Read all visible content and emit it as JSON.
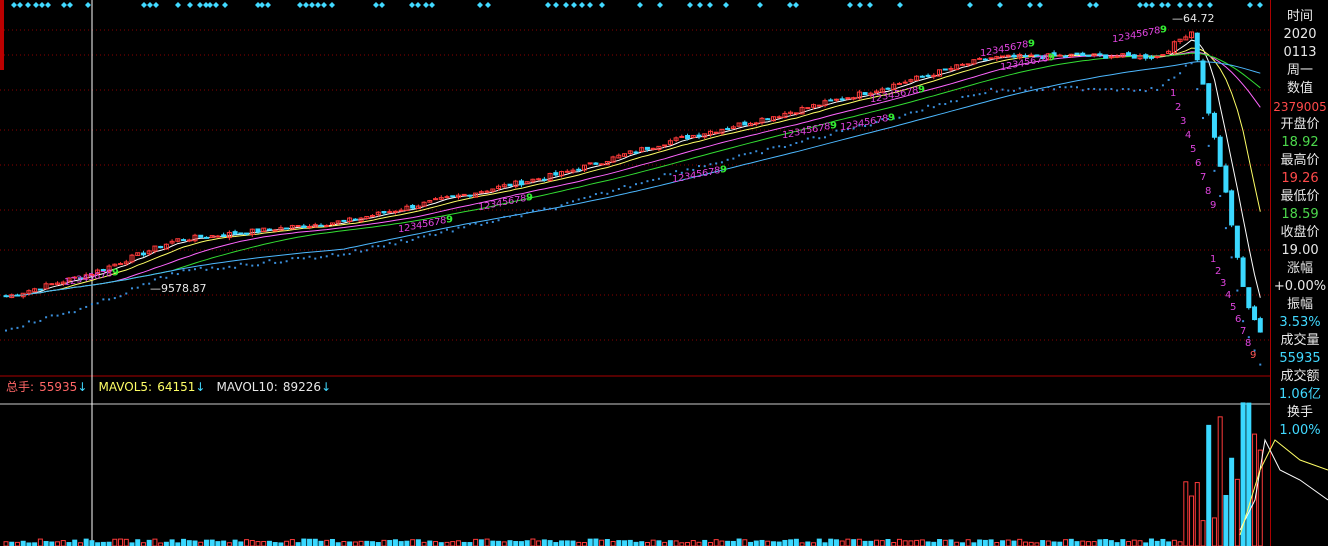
{
  "colors": {
    "background": "#000000",
    "up": "#ff3b3b",
    "down": "#3bd8ff",
    "ma5": "#ffffff",
    "ma10": "#ffff66",
    "ma20": "#ff66ff",
    "ma30": "#33dd33",
    "ma60": "#4db8ff",
    "seq_label": "#dd44dd",
    "nine_label": "#33ee33",
    "grid": "#8b0000"
  },
  "price_panel": {
    "high_marker": "64.72",
    "low_marker": "9578.87"
  },
  "volume_legend": {
    "total_label": "总手:",
    "total_value": "55935",
    "total_arrow": "↓",
    "mavol5_label": "MAVOL5:",
    "mavol5_value": "64151",
    "mavol5_arrow": "↓",
    "mavol10_label": "MAVOL10:",
    "mavol10_value": "89226",
    "mavol10_arrow": "↓"
  },
  "info_panel": {
    "time_label": "时间",
    "year": "2020",
    "date": "0113",
    "weekday": "周一",
    "value_label": "数值",
    "value": "2379005",
    "open_label": "开盘价",
    "open": "18.92",
    "high_label": "最高价",
    "high": "19.26",
    "low_label": "最低价",
    "low": "18.59",
    "close_label": "收盘价",
    "close": "19.00",
    "change_label": "涨幅",
    "change": "+0.00%",
    "amplitude_label": "振幅",
    "amplitude": "3.53%",
    "volume_label": "成交量",
    "volume": "55935",
    "turnover_label": "成交额",
    "turnover": "1.06亿",
    "turnover_rate_label": "换手",
    "turnover_rate": "1.00%"
  },
  "chart_data": {
    "type": "candlestick",
    "title": "",
    "ylabel": "",
    "xlabel": "",
    "grid": true,
    "legend": "none",
    "price_anchor": [
      8.0,
      9.6,
      12.5,
      14.5,
      17.5,
      21.0,
      27.0,
      33.0,
      41.0,
      52.0,
      53.0,
      52.5,
      64.72,
      20.0,
      8.0,
      5.5
    ],
    "price_anchor_x": [
      0,
      80,
      160,
      320,
      420,
      520,
      620,
      720,
      820,
      920,
      1000,
      1080,
      1110,
      1140,
      1160,
      1180
    ],
    "bar_count": 220,
    "volume_scale": "relative",
    "volume_spike_bars": [
      210,
      212,
      213,
      214,
      215,
      216,
      217,
      218,
      219
    ],
    "ma_lines": [
      "MA5",
      "MA10",
      "MA20",
      "MA30",
      "MA60"
    ],
    "sequence_labels": [
      "1",
      "2",
      "3",
      "4",
      "5",
      "6",
      "7",
      "8",
      "9"
    ],
    "mavol": {
      "MAVOL5": 64151,
      "MAVOL10": 89226,
      "total": 55935
    }
  }
}
